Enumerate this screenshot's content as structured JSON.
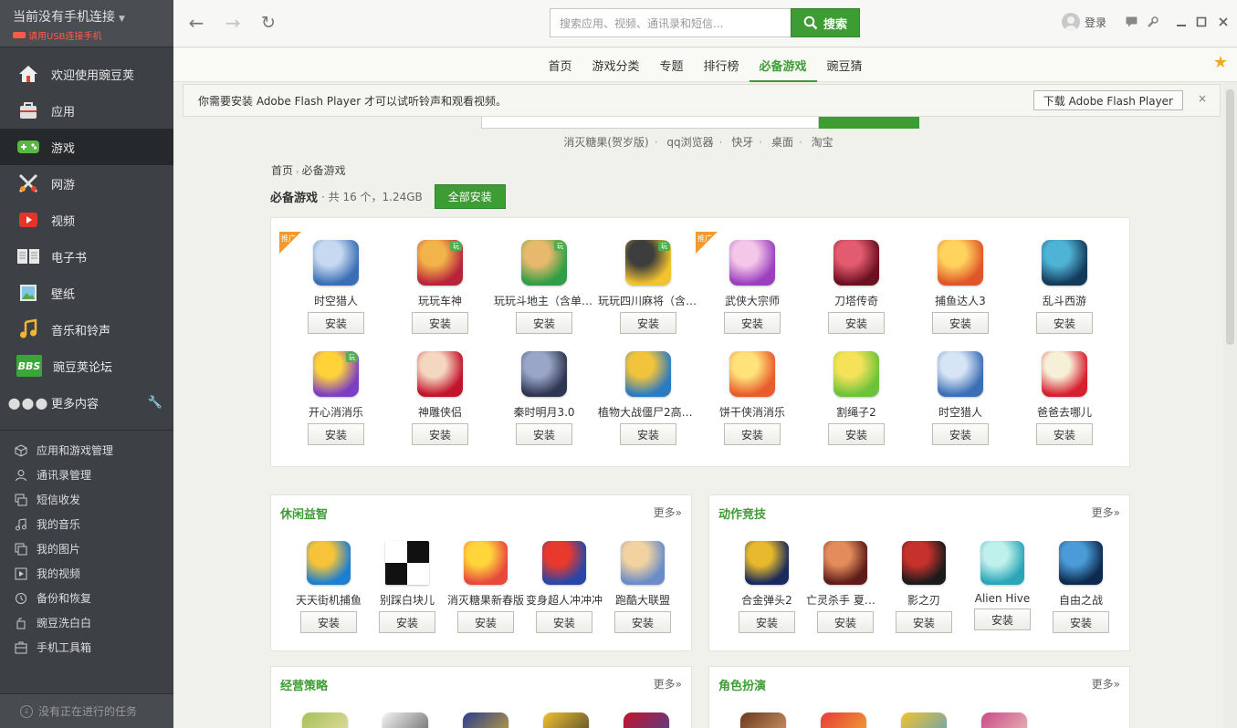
{
  "device": {
    "title": "当前没有手机连接",
    "hint": "请用USB连接手机"
  },
  "nav": [
    {
      "label": "欢迎使用豌豆荚",
      "icon": "home-icon"
    },
    {
      "label": "应用",
      "icon": "bag-icon"
    },
    {
      "label": "游戏",
      "icon": "gamepad-icon"
    },
    {
      "label": "网游",
      "icon": "crossed-swords-icon"
    },
    {
      "label": "视频",
      "icon": "video-play-icon"
    },
    {
      "label": "电子书",
      "icon": "book-icon"
    },
    {
      "label": "壁纸",
      "icon": "picture-icon"
    },
    {
      "label": "音乐和铃声",
      "icon": "music-note-icon"
    },
    {
      "label": "豌豆荚论坛",
      "icon": "bbs-icon",
      "icon_text": "BBS"
    },
    {
      "label": "更多内容",
      "icon": "more-dots-icon"
    }
  ],
  "tools": [
    {
      "label": "应用和游戏管理",
      "icon": "cube-icon"
    },
    {
      "label": "通讯录管理",
      "icon": "person-icon"
    },
    {
      "label": "短信收发",
      "icon": "message-icon"
    },
    {
      "label": "我的音乐",
      "icon": "music-icon"
    },
    {
      "label": "我的图片",
      "icon": "image-icon"
    },
    {
      "label": "我的视频",
      "icon": "video-icon"
    },
    {
      "label": "备份和恢复",
      "icon": "history-icon"
    },
    {
      "label": "豌豆洗白白",
      "icon": "bottle-icon"
    },
    {
      "label": "手机工具箱",
      "icon": "toolbox-icon"
    }
  ],
  "task_status": "没有正在进行的任务",
  "topbar": {
    "search_placeholder": "搜索应用、视频、通讯录和短信...",
    "search_button": "搜索",
    "login": "登录"
  },
  "tabs": [
    {
      "label": "首页",
      "active": false
    },
    {
      "label": "游戏分类",
      "active": false
    },
    {
      "label": "专题",
      "active": false
    },
    {
      "label": "排行榜",
      "active": false
    },
    {
      "label": "必备游戏",
      "active": true
    },
    {
      "label": "豌豆猜",
      "active": false
    }
  ],
  "flash": {
    "message": "你需要安装 Adobe Flash Player 才可以试听铃声和观看视频。",
    "button": "下载 Adobe Flash Player",
    "close": "×"
  },
  "hot_words": [
    "消灭糖果(贺岁版)",
    "qq浏览器",
    "快牙",
    "桌面",
    "淘宝"
  ],
  "breadcrumb": {
    "home": "首页",
    "sep": "›",
    "current": "必备游戏"
  },
  "section": {
    "name": "必备游戏",
    "meta": "· 共 16 个，1.24GB",
    "install_all": "全部安装"
  },
  "install_label": "安装",
  "featured_apps": [
    {
      "name": "时空猎人",
      "badge": "推广",
      "c1": "#3b6fb5",
      "c2": "#c7d9f0"
    },
    {
      "name": "玩玩车神",
      "badge": "",
      "g": "玩",
      "c1": "#b8233a",
      "c2": "#f1b34a"
    },
    {
      "name": "玩玩斗地主（含单机）",
      "badge": "",
      "g": "玩",
      "c1": "#2f9e44",
      "c2": "#e7b96c"
    },
    {
      "name": "玩玩四川麻将（含单机）",
      "badge": "",
      "g": "玩",
      "c1": "#f2c230",
      "c2": "#3d3d3d"
    },
    {
      "name": "武侠大宗师",
      "badge": "推广",
      "c1": "#9b3fbf",
      "c2": "#f4c6e8"
    },
    {
      "name": "刀塔传奇",
      "badge": "",
      "c1": "#6b1020",
      "c2": "#e25b6e"
    },
    {
      "name": "捕鱼达人3",
      "badge": "",
      "c1": "#e0562a",
      "c2": "#ffd45e"
    },
    {
      "name": "乱斗西游",
      "badge": "",
      "c1": "#143a5a",
      "c2": "#4fb3d6"
    },
    {
      "name": "开心消消乐",
      "badge": "",
      "g": "玩",
      "c1": "#7c3fc4",
      "c2": "#ffd23a"
    },
    {
      "name": "神雕侠侣",
      "badge": "",
      "c1": "#c2132a",
      "c2": "#f4d7c1"
    },
    {
      "name": "秦时明月3.0",
      "badge": "",
      "c1": "#2e3550",
      "c2": "#9aa6c8"
    },
    {
      "name": "植物大战僵尸2高清版",
      "badge": "",
      "c1": "#2c7bc0",
      "c2": "#f2c33c"
    },
    {
      "name": "饼干侠消消乐",
      "badge": "",
      "c1": "#e85b2d",
      "c2": "#ffe27a"
    },
    {
      "name": "割绳子2",
      "badge": "",
      "c1": "#6cc33b",
      "c2": "#f4e25a"
    },
    {
      "name": "时空猎人",
      "badge": "",
      "c1": "#3b6fb5",
      "c2": "#d6e4f5"
    },
    {
      "name": "爸爸去哪儿",
      "badge": "",
      "c1": "#d6202e",
      "c2": "#f7f0d8"
    }
  ],
  "categories": [
    {
      "title": "休闲益智",
      "more": "更多»",
      "apps": [
        {
          "name": "天天街机捕鱼",
          "c1": "#1d7fd1",
          "c2": "#f6c33a"
        },
        {
          "name": "别踩白块儿",
          "c1": "#111111",
          "c2": "#ffffff",
          "checker": true
        },
        {
          "name": "消灭糖果新春版",
          "c1": "#e7493c",
          "c2": "#ffd53b"
        },
        {
          "name": "变身超人冲冲冲",
          "c1": "#2846a8",
          "c2": "#e8392c"
        },
        {
          "name": "跑酷大联盟",
          "c1": "#6b8cc9",
          "c2": "#f2d3a0"
        }
      ]
    },
    {
      "title": "动作竞技",
      "more": "更多»",
      "apps": [
        {
          "name": "合金弹头2",
          "c1": "#1a2a5c",
          "c2": "#e8b92c"
        },
        {
          "name": "亡灵杀手 夏侯惇",
          "c1": "#5e1d18",
          "c2": "#e28b5c"
        },
        {
          "name": "影之刃",
          "c1": "#1b1b1b",
          "c2": "#c7312c"
        },
        {
          "name": "Alien Hive",
          "c1": "#2aa6b8",
          "c2": "#bff0ec"
        },
        {
          "name": "自由之战",
          "c1": "#0d2a4e",
          "c2": "#4a9bd8"
        }
      ]
    },
    {
      "title": "经营策略",
      "more": "更多»"
    },
    {
      "title": "角色扮演",
      "more": "更多»"
    }
  ]
}
